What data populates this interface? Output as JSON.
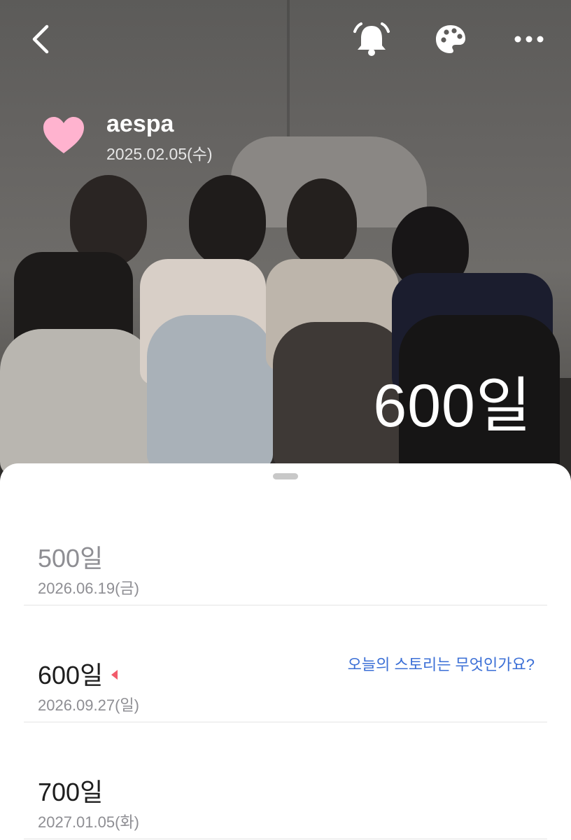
{
  "header": {
    "back_icon": "chevron-left-icon",
    "bell_icon": "bell-icon",
    "palette_icon": "palette-icon",
    "more_icon": "more-horizontal-icon"
  },
  "profile": {
    "name": "aespa",
    "start_date": "2025.02.05(수)",
    "heart_color": "#ffb3cf",
    "heart_icon": "heart-icon"
  },
  "hero": {
    "count_label": "600일"
  },
  "sheet": {
    "items": [
      {
        "label": "500일",
        "date": "2026.06.19(금)",
        "state": "past"
      },
      {
        "label": "600일",
        "date": "2026.09.27(일)",
        "state": "current",
        "prompt": "오늘의 스토리는 무엇인가요?"
      },
      {
        "label": "700일",
        "date": "2027.01.05(화)",
        "state": "future"
      }
    ],
    "accent_color": "#f25b6b",
    "link_color": "#3b6fd6"
  }
}
